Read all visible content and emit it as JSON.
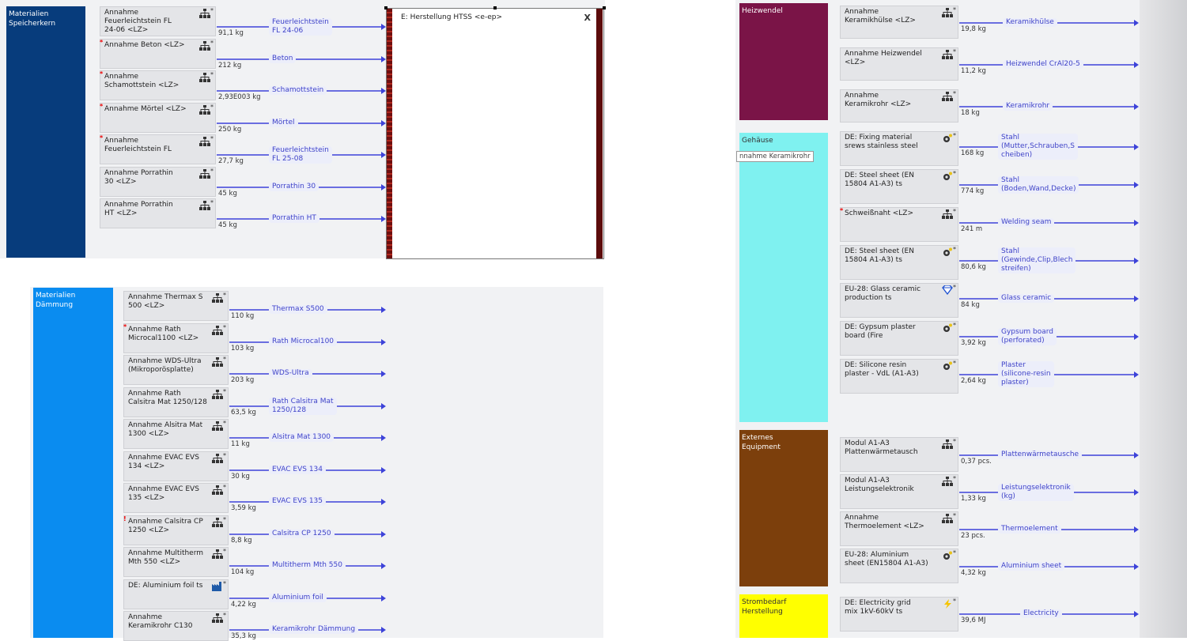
{
  "colors": {
    "speicherkern": "#073c7c",
    "daemmung": "#0a8cf0",
    "heizwendel": "#7a1447",
    "gehaeuse": "#7ff1f0",
    "externes": "#7c3f0c",
    "strombedarf": "#ffff00",
    "flow": "#3d43d9"
  },
  "categories": {
    "speicherkern": "Materialien\nSpeicherkern",
    "daemmung": "Materialien\nDämmung",
    "heizwendel": "Heizwendel",
    "gehaeuse": "Gehäuse",
    "externes": "Externes\nEquipment",
    "strombedarf": "Strombedarf\nHerstellung"
  },
  "process_box": {
    "title": "E: Herstellung HTSS <e-ep>",
    "close_glyph": "X"
  },
  "tooltip": "nnahme Keramikrohr",
  "speicherkern_items": [
    {
      "node": "Annahme\nFeuerleichtstein FL\n24-06 <LZ>",
      "qty": "91,1 kg",
      "flow": "Feuerleichtstein\nFL 24-06",
      "icon": "plan-icon"
    },
    {
      "node": "Annahme Beton <LZ>",
      "qty": "212 kg",
      "flow": "Beton",
      "icon": "plan-icon",
      "flag": "*"
    },
    {
      "node": "Annahme\nSchamottstein <LZ>",
      "qty": "2,93E003 kg",
      "flow": "Schamottstein",
      "icon": "plan-icon",
      "flag": "*"
    },
    {
      "node": "Annahme Mörtel <LZ>",
      "qty": "250 kg",
      "flow": "Mörtel",
      "icon": "plan-icon",
      "flag": "*"
    },
    {
      "node": "Annahme\nFeuerleichtstein FL",
      "qty": "27,7 kg",
      "flow": "Feuerleichtstein\nFL 25-08",
      "icon": "plan-icon",
      "flag": "*"
    },
    {
      "node": "Annahme Porrathin\n30 <LZ>",
      "qty": "45 kg",
      "flow": "Porrathin 30",
      "icon": "plan-icon"
    },
    {
      "node": "Annahme Porrathin\nHT <LZ>",
      "qty": "45 kg",
      "flow": "Porrathin HT",
      "icon": "plan-icon"
    }
  ],
  "daemmung_items": [
    {
      "node": "Annahme Thermax S\n500 <LZ>",
      "qty": "110 kg",
      "flow": "Thermax S500",
      "icon": "plan-icon"
    },
    {
      "node": "Annahme Rath\nMicrocal1100 <LZ>",
      "qty": "103 kg",
      "flow": "Rath Microcal100",
      "icon": "plan-icon",
      "flag": "*"
    },
    {
      "node": "Annahme WDS-Ultra\n(Mikroporösplatte)",
      "qty": "203 kg",
      "flow": "WDS-Ultra",
      "icon": "plan-icon"
    },
    {
      "node": "Annahme Rath\nCalsitra Mat 1250/128",
      "qty": "63,5 kg",
      "flow": "Rath Calsitra Mat\n1250/128",
      "icon": "plan-icon"
    },
    {
      "node": "Annahme Alsitra Mat\n1300 <LZ>",
      "qty": "11 kg",
      "flow": "Alsitra Mat 1300",
      "icon": "plan-icon"
    },
    {
      "node": "Annahme EVAC EVS\n134 <LZ>",
      "qty": "30 kg",
      "flow": "EVAC EVS 134",
      "icon": "plan-icon"
    },
    {
      "node": "Annahme EVAC EVS\n135 <LZ>",
      "qty": "3,59 kg",
      "flow": "EVAC EVS 135",
      "icon": "plan-icon"
    },
    {
      "node": "Annahme Calsitra CP\n1250 <LZ>",
      "qty": "8,8 kg",
      "flow": "Calsitra CP 1250",
      "icon": "plan-icon",
      "flag": "!"
    },
    {
      "node": "Annahme Multitherm\nMth 550 <LZ>",
      "qty": "104 kg",
      "flow": "Multitherm Mth 550",
      "icon": "plan-icon"
    },
    {
      "node": "DE: Aluminium foil ts",
      "qty": "4,22 kg",
      "flow": "Aluminium foil",
      "icon": "factory-icon"
    },
    {
      "node": "Annahme\nKeramikrohr C130",
      "qty": "35,3 kg",
      "flow": "Keramikrohr Dämmung",
      "icon": "plan-icon"
    }
  ],
  "heizwendel_items": [
    {
      "node": "Annahme\nKeramikhülse <LZ>",
      "qty": "19,8 kg",
      "flow": "Keramikhülse",
      "icon": "plan-icon"
    },
    {
      "node": "Annahme Heizwendel\n<LZ>",
      "qty": "11,2 kg",
      "flow": "Heizwendel CrAl20-5",
      "icon": "plan-icon"
    },
    {
      "node": "Annahme\nKeramikrohr <LZ>",
      "qty": "18 kg",
      "flow": "Keramikrohr",
      "icon": "plan-icon"
    }
  ],
  "gehaeuse_items": [
    {
      "node": "DE: Fixing material\nsrews stainless steel",
      "qty": "168 kg",
      "flow": "Stahl\n(Mutter,Schrauben,S\ncheiben)",
      "icon": "gear-icon"
    },
    {
      "node": "DE: Steel sheet (EN\n15804 A1-A3) ts",
      "qty": "774 kg",
      "flow": "Stahl\n(Boden,Wand,Decke)",
      "icon": "gear-icon"
    },
    {
      "node": "Schweißnaht <LZ>",
      "qty": "241 m",
      "flow": "Welding seam",
      "icon": "plan-icon",
      "flag": "*"
    },
    {
      "node": "DE: Steel sheet (EN\n15804 A1-A3) ts",
      "qty": "80,6 kg",
      "flow": "Stahl\n(Gewinde,Clip,Blech\nstreifen)",
      "icon": "gear-icon"
    },
    {
      "node": "EU-28: Glass ceramic\nproduction ts",
      "qty": "84 kg",
      "flow": "Glass ceramic",
      "icon": "diamond-icon"
    },
    {
      "node": "DE: Gypsum plaster\nboard (Fire",
      "qty": "3,92 kg",
      "flow": "Gypsum board\n(perforated)",
      "icon": "gear-icon"
    },
    {
      "node": "DE: Silicone resin\nplaster - VdL (A1-A3)",
      "qty": "2,64 kg",
      "flow": "Plaster\n(silicone-resin\nplaster)",
      "icon": "gear-icon"
    }
  ],
  "externes_items": [
    {
      "node": "Modul A1-A3\nPlattenwärmetausch",
      "qty": "0,37 pcs.",
      "flow": "Plattenwärmetausche",
      "icon": "plan-icon"
    },
    {
      "node": "Modul A1-A3\nLeistungselektronik",
      "qty": "1,33 kg",
      "flow": "Leistungselektronik\n(kg)",
      "icon": "plan-icon"
    },
    {
      "node": "Annahme\nThermoelement <LZ>",
      "qty": "23 pcs.",
      "flow": "Thermoelement",
      "icon": "plan-icon"
    },
    {
      "node": "EU-28: Aluminium\nsheet (EN15804 A1-A3)",
      "qty": "4,32 kg",
      "flow": "Aluminium sheet",
      "icon": "gear-icon"
    }
  ],
  "strom_items": [
    {
      "node": "DE: Electricity grid\nmix 1kV-60kV ts",
      "qty": "39,6 MJ",
      "flow": "Electricity",
      "icon": "lightning-icon"
    }
  ]
}
